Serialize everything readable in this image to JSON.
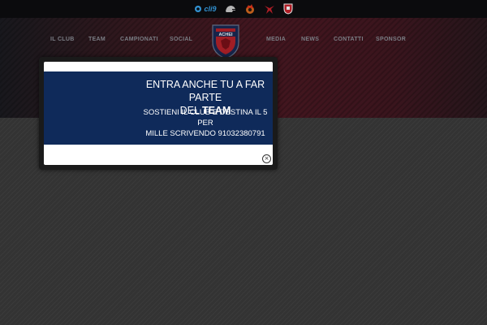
{
  "sponsors": [
    {
      "name": "cli9-logo",
      "label": "cli9"
    },
    {
      "name": "sponsor-helmet-logo",
      "label": ""
    },
    {
      "name": "sponsor-flame-logo",
      "label": ""
    },
    {
      "name": "sponsor-wing-logo",
      "label": ""
    },
    {
      "name": "sponsor-shield-logo",
      "label": ""
    }
  ],
  "nav": {
    "left": [
      "IL CLUB",
      "TEAM",
      "CAMPIONATI",
      "SOCIAL"
    ],
    "right": [
      "MEDIA",
      "NEWS",
      "CONTATTI",
      "SPONSOR"
    ]
  },
  "crest": {
    "text": "ACHEI"
  },
  "popup": {
    "heading_line1": "ENTRA ANCHE TU A FAR PARTE",
    "heading_line2_prefix": "DEL ",
    "heading_line2_bold": "TEAM",
    "body_line1": "SOSTIENI IL CLUB E DESTINA IL 5 PER",
    "body_line2": "MILLE SCRIVENDO  91032380791",
    "close_label": "×"
  },
  "colors": {
    "topbar": "#0d0d0f",
    "popup_banner": "#0f2a5a",
    "nav_text": "#8b8f97",
    "accent_red": "#c8232c"
  }
}
